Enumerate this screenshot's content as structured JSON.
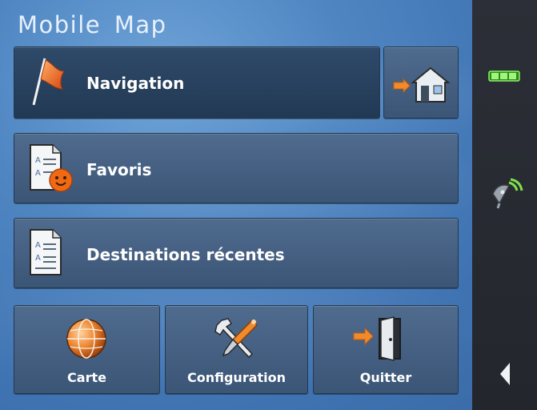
{
  "app": {
    "title": "Mobile Map"
  },
  "menu": {
    "navigation": {
      "label": "Navigation",
      "icon": "flag-icon"
    },
    "home": {
      "icon": "home-icon"
    },
    "favorites": {
      "label": "Favoris",
      "icon": "favorites-list-icon"
    },
    "recent": {
      "label": "Destinations récentes",
      "icon": "document-list-icon"
    }
  },
  "bottom": [
    {
      "label": "Carte",
      "icon": "globe-icon"
    },
    {
      "label": "Configuration",
      "icon": "tools-icon"
    },
    {
      "label": "Quitter",
      "icon": "exit-door-icon"
    }
  ],
  "sidebar": {
    "battery_icon": "battery-icon",
    "signal_icon": "satellite-signal-icon",
    "back_icon": "back-arrow-icon",
    "battery_color": "#3ad21e"
  }
}
